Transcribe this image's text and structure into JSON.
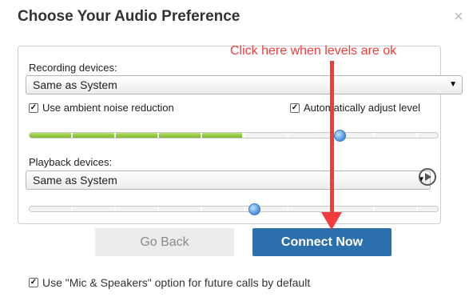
{
  "dialog": {
    "title": "Choose Your Audio Preference",
    "close_glyph": "×"
  },
  "recording": {
    "label": "Recording devices:",
    "selected": "Same as System",
    "ambient_label": "Use ambient noise reduction",
    "ambient_checked": true,
    "auto_label": "Automatically adjust level",
    "auto_checked": true,
    "level_fraction": 0.52,
    "slider_fraction": 0.76
  },
  "playback": {
    "label": "Playback devices:",
    "selected": "Same as System",
    "slider_fraction": 0.55,
    "play_icon": "play-icon"
  },
  "buttons": {
    "back": "Go Back",
    "connect": "Connect Now"
  },
  "annotation": {
    "text": "Click here when levels are ok",
    "color": "#f43b3b"
  },
  "footer": {
    "default_label": "Use \"Mic & Speakers\" option for future calls by default",
    "default_checked": true
  },
  "colors": {
    "accent": "#2c6fad",
    "level_green": "#7cb828"
  }
}
